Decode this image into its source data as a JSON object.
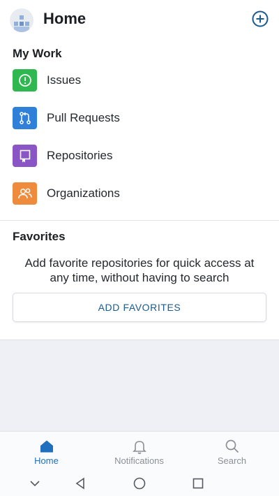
{
  "header": {
    "title": "Home",
    "avatar_icon": "user-avatar-icon",
    "add_icon": "plus-circle-icon"
  },
  "my_work": {
    "title": "My Work",
    "items": [
      {
        "label": "Issues",
        "icon": "issue-opened-icon",
        "color": "#2eb84f"
      },
      {
        "label": "Pull Requests",
        "icon": "pull-request-icon",
        "color": "#2f80d8"
      },
      {
        "label": "Repositories",
        "icon": "repo-icon",
        "color": "#8a55c4"
      },
      {
        "label": "Organizations",
        "icon": "organization-icon",
        "color": "#ef8b3c"
      }
    ]
  },
  "favorites": {
    "title": "Favorites",
    "description": "Add favorite repositories for quick access at any time, without having to search",
    "button_label": "ADD FAVORITES"
  },
  "bottom_nav": {
    "items": [
      {
        "label": "Home",
        "icon": "home-icon",
        "active": true
      },
      {
        "label": "Notifications",
        "icon": "bell-icon",
        "active": false
      },
      {
        "label": "Search",
        "icon": "search-icon",
        "active": false
      }
    ]
  },
  "colors": {
    "accent": "#1a5b8f",
    "nav_active": "#1f6fbf",
    "nav_inactive": "#8b9096"
  }
}
